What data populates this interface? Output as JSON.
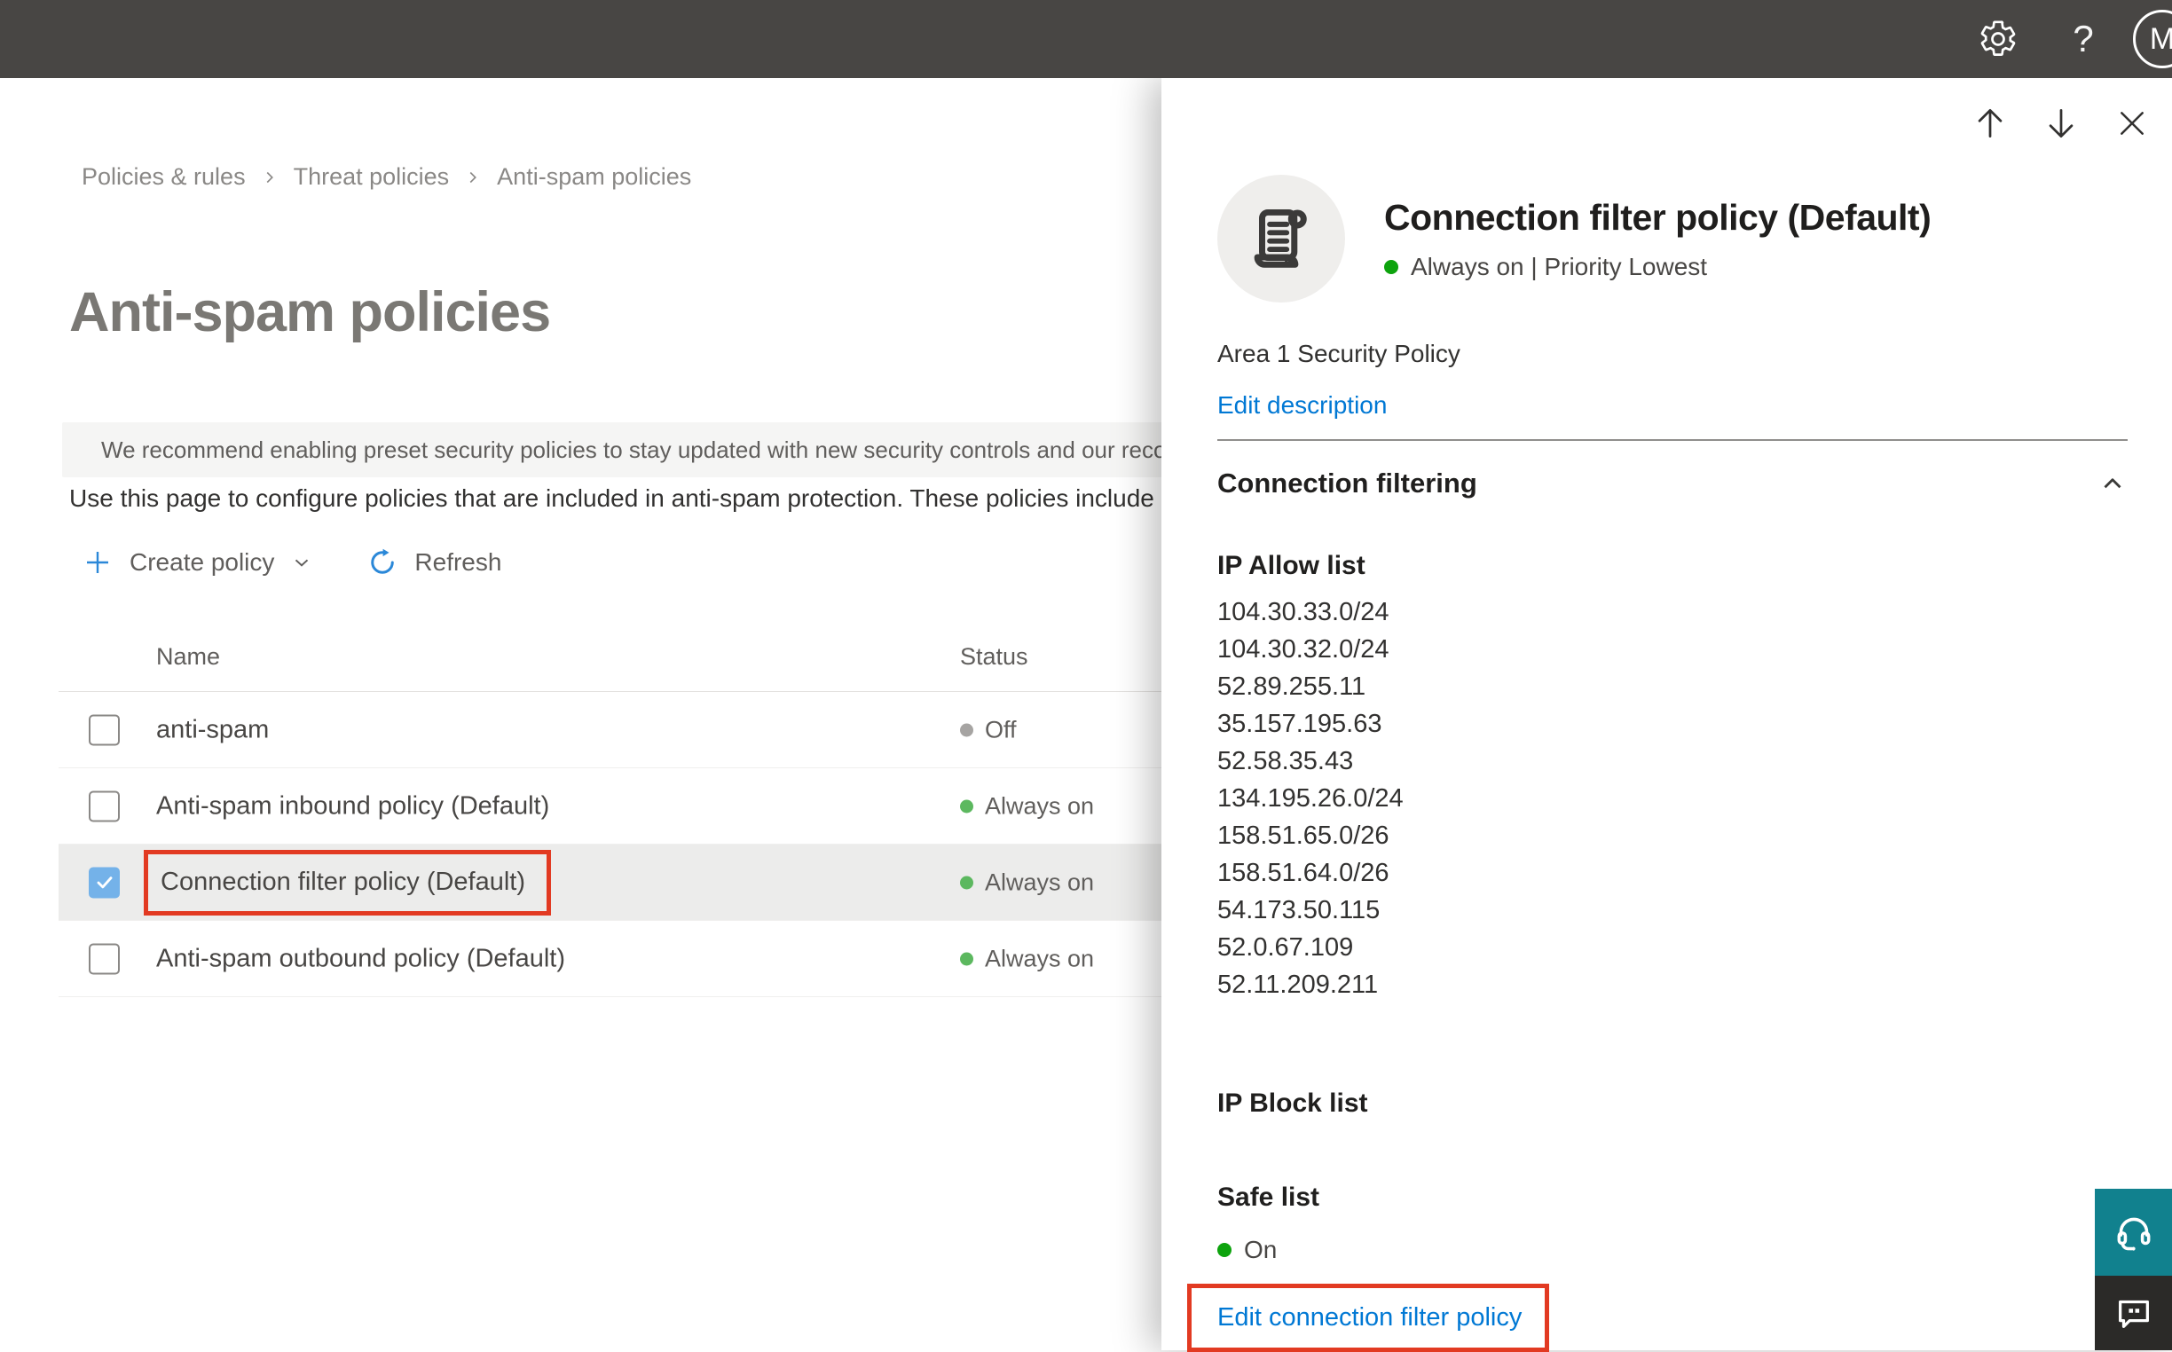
{
  "topbar": {
    "help_glyph": "?",
    "avatar_initial": "M"
  },
  "breadcrumb": {
    "items": [
      "Policies & rules",
      "Threat policies",
      "Anti-spam policies"
    ]
  },
  "page": {
    "title": "Anti-spam policies",
    "banner_text": "We recommend enabling preset security policies to stay updated with new security controls and our recomme",
    "description": "Use this page to configure policies that are included in anti-spam protection. These policies include"
  },
  "toolbar": {
    "create_label": "Create policy",
    "refresh_label": "Refresh"
  },
  "table": {
    "columns": [
      "Name",
      "Status"
    ],
    "rows": [
      {
        "name": "anti-spam",
        "status": "Off",
        "checked": false,
        "selected": false
      },
      {
        "name": "Anti-spam inbound policy (Default)",
        "status": "Always on",
        "checked": false,
        "selected": false
      },
      {
        "name": "Connection filter policy (Default)",
        "status": "Always on",
        "checked": true,
        "selected": true
      },
      {
        "name": "Anti-spam outbound policy (Default)",
        "status": "Always on",
        "checked": false,
        "selected": false
      }
    ]
  },
  "panel": {
    "title": "Connection filter policy (Default)",
    "status_line": "Always on | Priority Lowest",
    "description": "Area 1 Security Policy",
    "edit_description_label": "Edit description",
    "section_title": "Connection filtering",
    "ip_allow": {
      "label": "IP Allow list",
      "ips": [
        "104.30.33.0/24",
        "104.30.32.0/24",
        "52.89.255.11",
        "35.157.195.63",
        "52.58.35.43",
        "134.195.26.0/24",
        "158.51.65.0/26",
        "158.51.64.0/26",
        "54.173.50.115",
        "52.0.67.109",
        "52.11.209.211"
      ]
    },
    "ip_block_label": "IP Block list",
    "safe_list": {
      "label": "Safe list",
      "value": "On"
    },
    "edit_link_label": "Edit connection filter policy"
  },
  "icons": {
    "settings": "gear",
    "help": "question-mark",
    "policy": "scroll",
    "banner": "lightbulb",
    "create": "plus",
    "refresh": "circular-arrow",
    "nav_up": "arrow-up",
    "nav_down": "arrow-down",
    "close": "x",
    "collapse": "chevron-up",
    "support": "headset",
    "feedback": "chat-bubble"
  },
  "colors": {
    "accent": "#0078d4",
    "annotation_red": "#e23a22",
    "status_green": "#5cb85f",
    "status_green_bright": "#0da30d",
    "status_gray": "#a6a4a2",
    "selected_checkbox": "#74b2e9",
    "topbar_bg": "#484644",
    "support_teal": "#11818e",
    "feedback_dark": "#2b2a28"
  }
}
